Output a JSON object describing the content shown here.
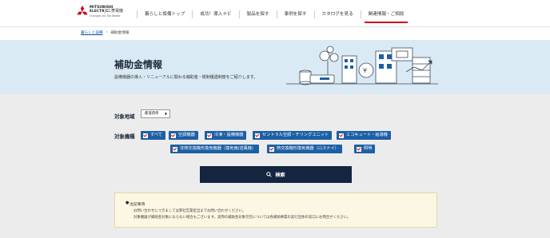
{
  "brand": {
    "name_line1": "MITSUBISHI",
    "name_line2": "ELECTRIC",
    "slogan": "Changes for the Better",
    "jp_name": "三菱電機",
    "accent": "#d0021b"
  },
  "nav": {
    "items": [
      {
        "label": "暮らしと設備トップ",
        "active": false
      },
      {
        "label": "成功！導入ナビ",
        "active": false
      },
      {
        "label": "製品を探す",
        "active": false
      },
      {
        "label": "事例を探す",
        "active": false
      },
      {
        "label": "カタログを見る",
        "active": false
      },
      {
        "label": "関連情報・ご相談",
        "active": true
      }
    ]
  },
  "breadcrumb": {
    "home": "暮らしと設備",
    "separator": "›",
    "current": "補助金情報"
  },
  "hero": {
    "title": "補助金情報",
    "description": "設備機器の導入・リニューアルに関わる補助金・税制優遇制度をご紹介します。",
    "bg_color": "#daeaf5"
  },
  "filter": {
    "region_label": "対象地域",
    "region_select": "都道府県",
    "category_label": "対象機種",
    "categories": [
      "すべて",
      "空調機器",
      "冷凍・設備機器",
      "セントラル空調・チリングユニット",
      "エコキュート・給湯機",
      "非熱交換機形換気機器（換気扇/送風機）",
      "熱交換機形換気機器（ロスナイ）",
      "照明"
    ],
    "button_color": "#1d5fa5",
    "search_label": "検索",
    "search_color": "#14253f"
  },
  "note": {
    "title": "注記事項",
    "line1": "お問い合わせにつきましては弊社営業担当までお問い合わせください。",
    "line2": "対象機器が補助金対象にならない場合もございます。実際の補助金対象可否については各補助事業の実行団体の窓口にお問合せください。"
  }
}
